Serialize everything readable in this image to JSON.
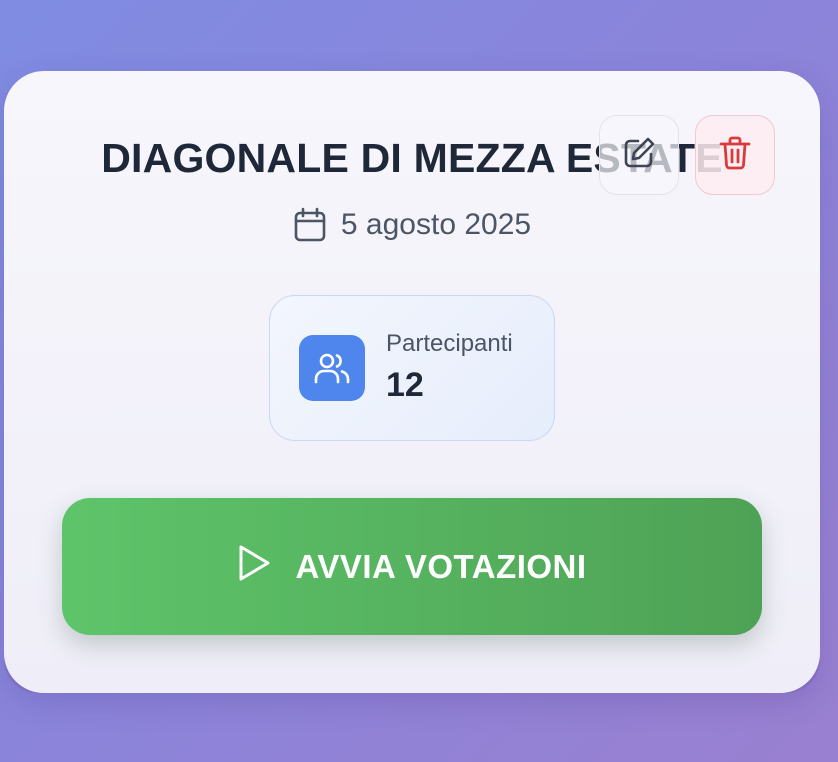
{
  "event": {
    "title": "DIAGONALE DI MEZZA ESTATE",
    "date": "5 agosto 2025"
  },
  "stats": {
    "participants_label": "Partecipanti",
    "participants_value": "12"
  },
  "actions": {
    "start_label": "AVVIA VOTAZIONI"
  },
  "icons": {
    "date": "calendar-icon",
    "edit": "edit-icon",
    "delete": "trash-icon",
    "participants": "users-icon",
    "start": "play-icon"
  },
  "colors": {
    "accent_blue": "#4e86ee",
    "start_green": "#5ec46a",
    "delete_red": "#d93b3b"
  }
}
